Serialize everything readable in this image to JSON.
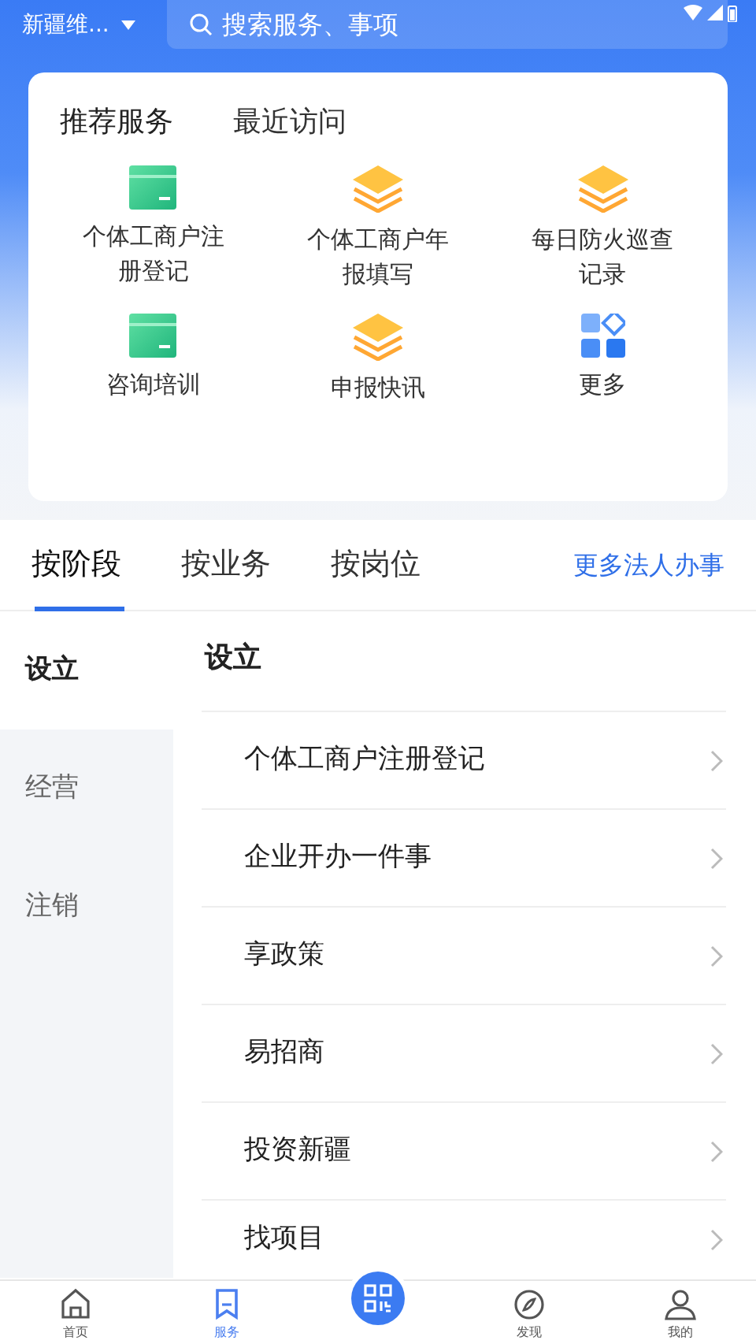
{
  "top_bar": {
    "location": "新疆维...",
    "search": {
      "placeholder": "搜索服务、事项"
    }
  },
  "service_card": {
    "tabs": [
      {
        "label": "推荐服务",
        "selected": true
      },
      {
        "label": "最近访问",
        "selected": false
      }
    ],
    "items": [
      {
        "label": "个体工商户注册登记",
        "kind": "card"
      },
      {
        "label": "个体工商户年报填写",
        "kind": "layers"
      },
      {
        "label": "每日防火巡查记录",
        "kind": "layers"
      },
      {
        "label": "咨询培训",
        "kind": "card"
      },
      {
        "label": "申报快讯",
        "kind": "layers"
      },
      {
        "label": "更多",
        "kind": "grid"
      }
    ]
  },
  "category_tabs": [
    {
      "label": "按阶段",
      "selected": true
    },
    {
      "label": "按业务",
      "selected": false
    },
    {
      "label": "按岗位",
      "selected": false
    }
  ],
  "more_link": "更多法人办事",
  "sidebar": [
    {
      "label": "设立",
      "selected": true
    },
    {
      "label": "经营",
      "selected": false
    },
    {
      "label": "注销",
      "selected": false
    }
  ],
  "section_title": "设立",
  "services": [
    "个体工商户注册登记",
    "企业开办一件事",
    "享政策",
    "易招商",
    "投资新疆",
    "找项目"
  ],
  "bottom_nav": [
    {
      "label": "首页",
      "kind": "home",
      "selected": false
    },
    {
      "label": "服务",
      "kind": "bookmark",
      "selected": true
    },
    {
      "kind": "scan"
    },
    {
      "label": "发现",
      "kind": "compass",
      "selected": false
    },
    {
      "label": "我的",
      "kind": "person",
      "selected": false
    }
  ]
}
